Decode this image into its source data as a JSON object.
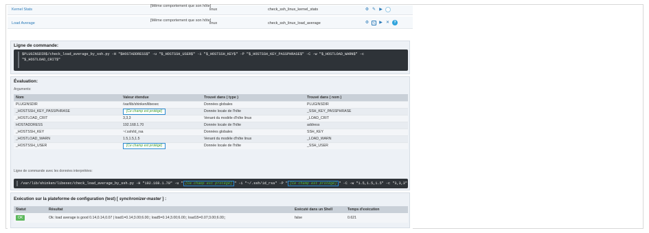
{
  "rows": [
    {
      "name": "Kernel Stats",
      "desc": "[Même comportement que son hôte]",
      "os": "linux",
      "check": "check_ssh_linux_kernel_stats"
    },
    {
      "name": "Load Average",
      "desc": "[Même comportement que son hôte]",
      "os": "linux",
      "check": "check_ssh_linux_load_average"
    }
  ],
  "command_section": {
    "title": "Ligne de commande:",
    "command": "$PLUGINSDIR$/check_load_average_by_ssh.py -H \"$HOSTADDRESS$\" -u \"$_HOSTSSH_USER$\" -i \"$_HOSTSSH_KEY$\" -P \"$_HOSTSSH_KEY_PASSPHRASE$\" -C -w \"$_HOSTLOAD_WARN$\" -c \"$_HOSTLOAD_CRIT$\""
  },
  "evaluation": {
    "title": "Évaluation:",
    "arguments_label": "Arguments:",
    "headers": [
      "Nom",
      "Valeur étendue",
      "Trouvé dans ( type )",
      "Trouvé dans ( nom )"
    ],
    "protected_label": "[Ce champ est protégé]",
    "args": [
      {
        "name": "PLUGINSDIR",
        "value": "/var/lib/shinken/libexec",
        "type": "Données globales",
        "source": "PLUGINSDIR"
      },
      {
        "name": "_HOSTSSH_KEY_PASSPHRASE",
        "value": "",
        "type": "Donnée locale de l'hôte",
        "source": "_SSH_KEY_PASSPHRASE",
        "protected": true
      },
      {
        "name": "_HOSTLOAD_CRIT",
        "value": "3,3,3",
        "type": "Venant du modèle d'hôte linux",
        "source": "_LOAD_CRIT"
      },
      {
        "name": "HOSTADDRESS",
        "value": "192.168.1.70",
        "type": "Donnée locale de l'hôte",
        "source": "address"
      },
      {
        "name": "_HOSTSSH_KEY",
        "value": "~/.ssh/id_rsa",
        "type": "Données globales",
        "source": "SSH_KEY"
      },
      {
        "name": "_HOSTLOAD_WARN",
        "value": "1.5,1.5,1.5",
        "type": "Venant du modèle d'hôte linux",
        "source": "_LOAD_WARN"
      },
      {
        "name": "_HOSTSSH_USER",
        "value": "",
        "type": "Donnée locale de l'hôte",
        "source": "_SSH_USER",
        "protected": true
      }
    ],
    "interpreted_label": "Ligne de commande avec les données interprétées:",
    "interpreted_parts": {
      "p1": "/var/lib/shinken/libexec/check_load_average_by_ssh.py -H \"192.168.1.70\" -u \"",
      "p2": "\" -i \"~/.ssh/id_rsa\" -P \"",
      "p3": "\" -C -w \"1.5,1.5,1.5\" -c \"3,3,3\""
    }
  },
  "execution": {
    "title_prefix": "Exécution sur la plateforme de configuration (test) [",
    "platform": "synchronizer-master",
    "title_suffix": "] :",
    "headers": [
      "Statut",
      "Résultat",
      "Exécuté dans un Shell",
      "Temps d'exécution"
    ],
    "status": "OK",
    "result": "Ok: load average is good 0.14,0.14,0.07 | load1=0.14;3.00;6.00;; load5=0.14;3.00;6.00;; load15=0.07;3.00;6.00;;",
    "shell": "false",
    "time": "0.621"
  }
}
